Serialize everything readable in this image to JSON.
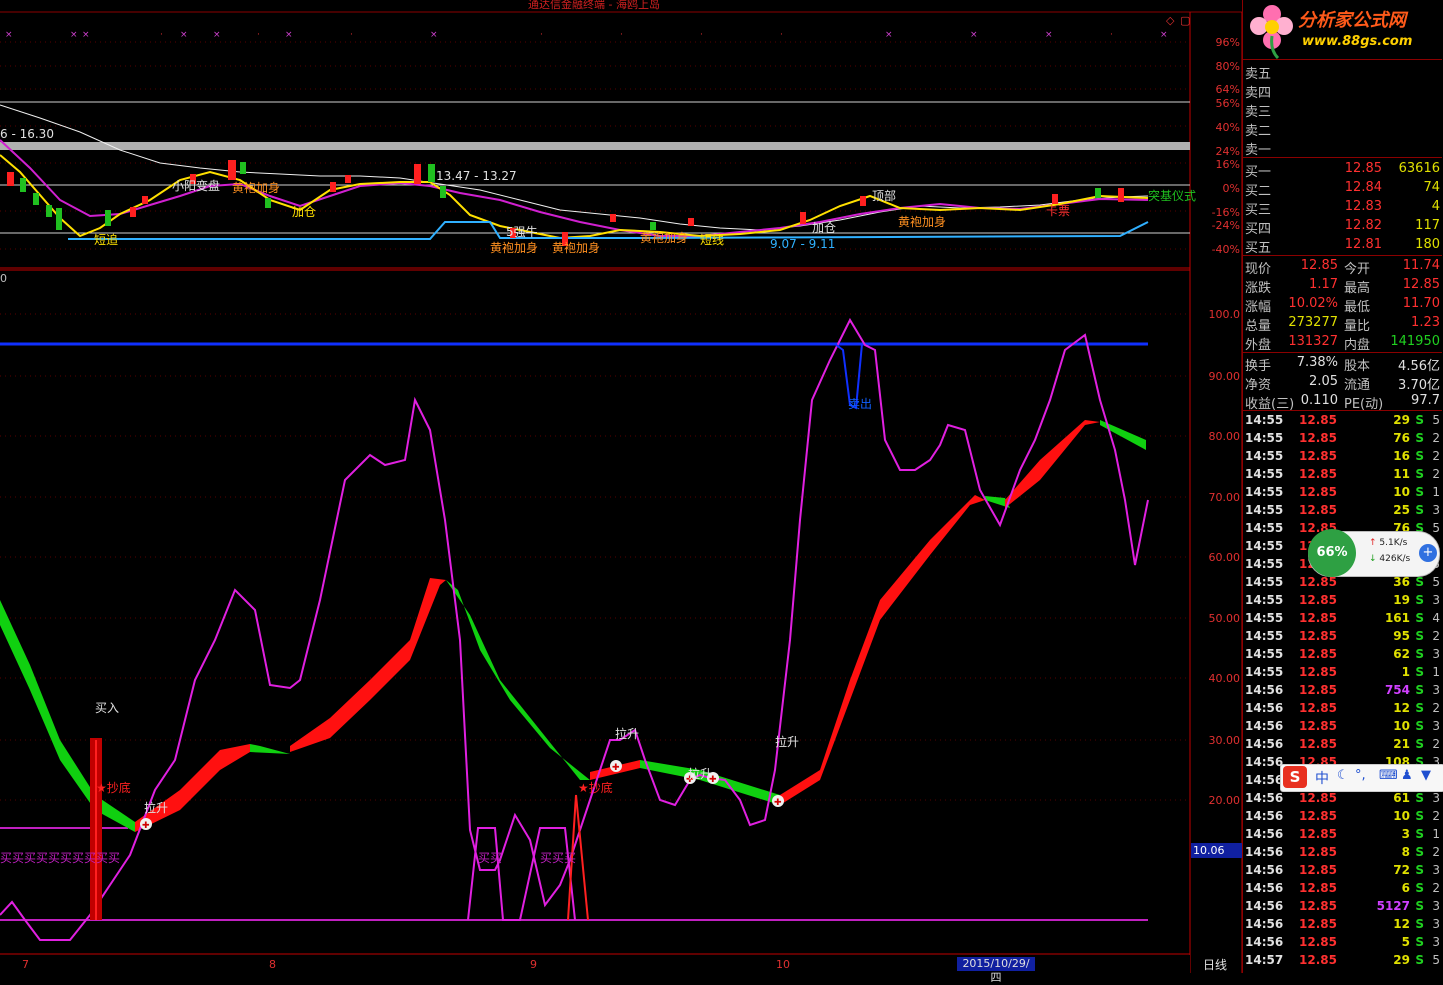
{
  "window": {
    "title": "通达信金融终端 - 海鸥上岛"
  },
  "brand": {
    "name": "分析家公式网",
    "url": "www.88gs.com"
  },
  "top_chart": {
    "right_axis": [
      "96%",
      "80%",
      "64%",
      "56%",
      "40%",
      "24%",
      "16%",
      "0%",
      "-16%",
      "-24%",
      "-40%"
    ],
    "price_range_labels": [
      "6 - 16.30",
      "13.47 - 13.27",
      "9.07 - 9.11"
    ],
    "annotations": [
      "小阳变盘",
      "黄袍加身",
      "加仓",
      "短追",
      "5强牛",
      "黄袍加身",
      "黄袍加身",
      "黄袍加身",
      "黄袍加身",
      "短线",
      "加仓",
      "顶部",
      "黄袍加身",
      "卡票",
      "突基仪式"
    ],
    "corner_icons": [
      "◇",
      "▢"
    ]
  },
  "bottom_chart": {
    "left_label": "0",
    "right_axis": [
      "100.0",
      "90.00",
      "80.00",
      "70.00",
      "60.00",
      "50.00",
      "40.00",
      "30.00",
      "20.00"
    ],
    "current_value": "10.06",
    "annotations": {
      "buy": "买入",
      "bottom_pick_1": "★抄底",
      "bottom_pick_2": "★抄底",
      "pull_up": [
        "拉升",
        "拉升",
        "拉升",
        "拉升"
      ],
      "sell": "卖出",
      "buy_strip": "买买买买买买买买买买",
      "buy_mid1": "买买",
      "buy_mid2": "买买买"
    }
  },
  "x_axis": {
    "labels": [
      "7",
      "8",
      "9",
      "10"
    ],
    "date": "2015/10/29/四",
    "period": "日线"
  },
  "quote": {
    "header_vol": "",
    "sell": [
      {
        "label": "卖五",
        "price": "",
        "vol": ""
      },
      {
        "label": "卖四",
        "price": "",
        "vol": ""
      },
      {
        "label": "卖三",
        "price": "",
        "vol": ""
      },
      {
        "label": "卖二",
        "price": "",
        "vol": ""
      },
      {
        "label": "卖一",
        "price": "",
        "vol": ""
      }
    ],
    "buy": [
      {
        "label": "买一",
        "price": "12.85",
        "vol": "63616"
      },
      {
        "label": "买二",
        "price": "12.84",
        "vol": "74"
      },
      {
        "label": "买三",
        "price": "12.83",
        "vol": "4"
      },
      {
        "label": "买四",
        "price": "12.82",
        "vol": "117"
      },
      {
        "label": "买五",
        "price": "12.81",
        "vol": "180"
      }
    ],
    "stats1": [
      {
        "l1": "现价",
        "v1": "12.85",
        "l2": "今开",
        "v2": "11.74"
      },
      {
        "l1": "涨跌",
        "v1": "1.17",
        "l2": "最高",
        "v2": "12.85"
      },
      {
        "l1": "涨幅",
        "v1": "10.02%",
        "l2": "最低",
        "v2": "11.70"
      },
      {
        "l1": "总量",
        "v1": "273277",
        "l2": "量比",
        "v2": "1.23"
      },
      {
        "l1": "外盘",
        "v1": "131327",
        "l2": "内盘",
        "v2": "141950"
      }
    ],
    "stats2": [
      {
        "l1": "换手",
        "v1": "7.38%",
        "l2": "股本",
        "v2": "4.56亿"
      },
      {
        "l1": "净资",
        "v1": "2.05",
        "l2": "流通",
        "v2": "3.70亿"
      },
      {
        "l1": "收益(三)",
        "v1": "0.110",
        "l2": "PE(动)",
        "v2": "97.7"
      }
    ]
  },
  "ticks": [
    {
      "t": "14:55",
      "p": "12.85",
      "v": "29",
      "s": "S",
      "n": "5"
    },
    {
      "t": "14:55",
      "p": "12.85",
      "v": "76",
      "s": "S",
      "n": "2"
    },
    {
      "t": "14:55",
      "p": "12.85",
      "v": "16",
      "s": "S",
      "n": "2"
    },
    {
      "t": "14:55",
      "p": "12.85",
      "v": "11",
      "s": "S",
      "n": "2"
    },
    {
      "t": "14:55",
      "p": "12.85",
      "v": "10",
      "s": "S",
      "n": "1"
    },
    {
      "t": "14:55",
      "p": "12.85",
      "v": "25",
      "s": "S",
      "n": "3"
    },
    {
      "t": "14:55",
      "p": "12.85",
      "v": "76",
      "s": "S",
      "n": "5"
    },
    {
      "t": "14:55",
      "p": "12.85",
      "v": "",
      "s": "S",
      "n": ""
    },
    {
      "t": "14:55",
      "p": "12.85",
      "v": "",
      "s": "S",
      "n": "5"
    },
    {
      "t": "14:55",
      "p": "12.85",
      "v": "36",
      "s": "S",
      "n": "5"
    },
    {
      "t": "14:55",
      "p": "12.85",
      "v": "19",
      "s": "S",
      "n": "3"
    },
    {
      "t": "14:55",
      "p": "12.85",
      "v": "161",
      "s": "S",
      "n": "4"
    },
    {
      "t": "14:55",
      "p": "12.85",
      "v": "95",
      "s": "S",
      "n": "2"
    },
    {
      "t": "14:55",
      "p": "12.85",
      "v": "62",
      "s": "S",
      "n": "3"
    },
    {
      "t": "14:55",
      "p": "12.85",
      "v": "1",
      "s": "S",
      "n": "1"
    },
    {
      "t": "14:56",
      "p": "12.85",
      "v": "754",
      "s": "S",
      "n": "3"
    },
    {
      "t": "14:56",
      "p": "12.85",
      "v": "12",
      "s": "S",
      "n": "2"
    },
    {
      "t": "14:56",
      "p": "12.85",
      "v": "10",
      "s": "S",
      "n": "3"
    },
    {
      "t": "14:56",
      "p": "12.85",
      "v": "21",
      "s": "S",
      "n": "2"
    },
    {
      "t": "14:56",
      "p": "12.85",
      "v": "108",
      "s": "S",
      "n": "3"
    },
    {
      "t": "14:56",
      "p": "",
      "v": "",
      "s": "",
      "n": ""
    },
    {
      "t": "14:56",
      "p": "12.85",
      "v": "61",
      "s": "S",
      "n": "3"
    },
    {
      "t": "14:56",
      "p": "12.85",
      "v": "10",
      "s": "S",
      "n": "2"
    },
    {
      "t": "14:56",
      "p": "12.85",
      "v": "3",
      "s": "S",
      "n": "1"
    },
    {
      "t": "14:56",
      "p": "12.85",
      "v": "8",
      "s": "S",
      "n": "2"
    },
    {
      "t": "14:56",
      "p": "12.85",
      "v": "72",
      "s": "S",
      "n": "3"
    },
    {
      "t": "14:56",
      "p": "12.85",
      "v": "6",
      "s": "S",
      "n": "2"
    },
    {
      "t": "14:56",
      "p": "12.85",
      "v": "5127",
      "s": "S",
      "n": "3"
    },
    {
      "t": "14:56",
      "p": "12.85",
      "v": "12",
      "s": "S",
      "n": "3"
    },
    {
      "t": "14:56",
      "p": "12.85",
      "v": "5",
      "s": "S",
      "n": "3"
    },
    {
      "t": "14:57",
      "p": "12.85",
      "v": "29",
      "s": "S",
      "n": "5"
    }
  ],
  "net_widget": {
    "percent": "66%",
    "up": "5.1K/s",
    "down": "426K/s"
  },
  "ime": {
    "logo": "S",
    "mode": "中"
  }
}
